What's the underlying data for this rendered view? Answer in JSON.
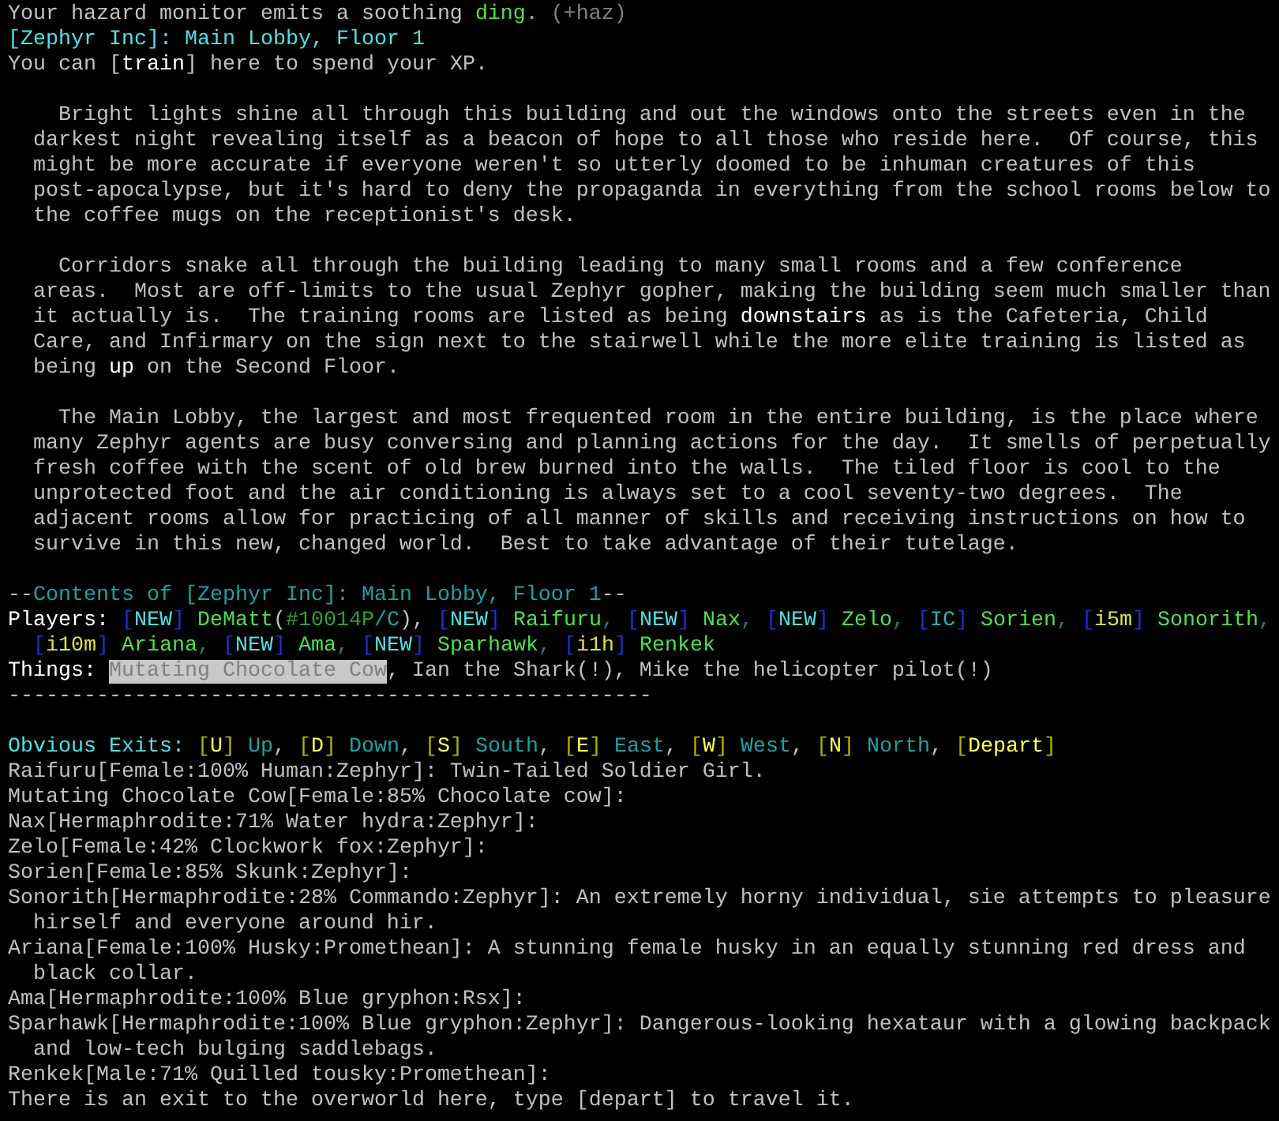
{
  "lines": [
    {
      "kind": "text",
      "segments": [
        {
          "text": "Your hazard monitor emits a soothing ",
          "color": "#c0c0c0"
        },
        {
          "text": "ding.",
          "color": "#4ee04e"
        },
        {
          "text": " (+haz)",
          "color": "#808080"
        }
      ]
    },
    {
      "kind": "text",
      "segments": [
        {
          "text": "[Zephyr Inc]: Main Lobby, Floor 1",
          "color": "#50e0e0"
        }
      ]
    },
    {
      "kind": "text",
      "segments": [
        {
          "text": "You can [",
          "color": "#c0c0c0"
        },
        {
          "text": "train",
          "color": "#ffffff"
        },
        {
          "text": "] here to spend your XP.",
          "color": "#c0c0c0"
        }
      ]
    },
    {
      "kind": "blank"
    },
    {
      "kind": "para",
      "segments": [
        {
          "text": "Bright lights shine all through this building and out the windows onto the streets even in the",
          "color": "#c0c0c0"
        }
      ]
    },
    {
      "kind": "wrap",
      "segments": [
        {
          "text": "darkest night revealing itself as a beacon of hope to all those who reside here.  Of course, this",
          "color": "#c0c0c0"
        }
      ]
    },
    {
      "kind": "wrap",
      "segments": [
        {
          "text": "might be more accurate if everyone weren't so utterly doomed to be inhuman creatures of this",
          "color": "#c0c0c0"
        }
      ]
    },
    {
      "kind": "wrap",
      "segments": [
        {
          "text": "post-apocalypse, but it's hard to deny the propaganda in everything from the school rooms below to",
          "color": "#c0c0c0"
        }
      ]
    },
    {
      "kind": "wrap",
      "segments": [
        {
          "text": "the coffee mugs on the receptionist's desk.",
          "color": "#c0c0c0"
        }
      ]
    },
    {
      "kind": "blank"
    },
    {
      "kind": "para",
      "segments": [
        {
          "text": "Corridors snake all through the building leading to many small rooms and a few conference",
          "color": "#c0c0c0"
        }
      ]
    },
    {
      "kind": "wrap",
      "segments": [
        {
          "text": "areas.  Most are off-limits to the usual Zephyr gopher, making the building seem much smaller than",
          "color": "#c0c0c0"
        }
      ]
    },
    {
      "kind": "wrap",
      "segments": [
        {
          "text": "it actually is.  The training rooms are listed as being ",
          "color": "#c0c0c0"
        },
        {
          "text": "downstairs",
          "color": "#ffffff"
        },
        {
          "text": " as is the Cafeteria, Child",
          "color": "#c0c0c0"
        }
      ]
    },
    {
      "kind": "wrap",
      "segments": [
        {
          "text": "Care, and Infirmary on the sign next to the stairwell while the more elite training is listed as",
          "color": "#c0c0c0"
        }
      ]
    },
    {
      "kind": "wrap",
      "segments": [
        {
          "text": "being ",
          "color": "#c0c0c0"
        },
        {
          "text": "up",
          "color": "#ffffff"
        },
        {
          "text": " on the Second Floor.",
          "color": "#c0c0c0"
        }
      ]
    },
    {
      "kind": "blank"
    },
    {
      "kind": "para",
      "segments": [
        {
          "text": "The Main Lobby, the largest and most frequented room in the entire building, is the place where",
          "color": "#c0c0c0"
        }
      ]
    },
    {
      "kind": "wrap",
      "segments": [
        {
          "text": "many Zephyr agents are busy conversing and planning actions for the day.  It smells of perpetually",
          "color": "#c0c0c0"
        }
      ]
    },
    {
      "kind": "wrap",
      "segments": [
        {
          "text": "fresh coffee with the scent of old brew burned into the walls.  The tiled floor is cool to the",
          "color": "#c0c0c0"
        }
      ]
    },
    {
      "kind": "wrap",
      "segments": [
        {
          "text": "unprotected foot and the air conditioning is always set to a cool seventy-two degrees.  The",
          "color": "#c0c0c0"
        }
      ]
    },
    {
      "kind": "wrap",
      "segments": [
        {
          "text": "adjacent rooms allow for practicing of all manner of skills and receiving instructions on how to",
          "color": "#c0c0c0"
        }
      ]
    },
    {
      "kind": "wrap",
      "segments": [
        {
          "text": "survive in this new, changed world.  Best to take advantage of their tutelage.",
          "color": "#c0c0c0"
        }
      ]
    },
    {
      "kind": "blank"
    },
    {
      "kind": "text",
      "segments": [
        {
          "text": "--",
          "color": "#c0c0c0"
        },
        {
          "text": "Contents of [Zephyr Inc]: Main Lobby, Floor 1",
          "color": "#20a0a0"
        },
        {
          "text": "--",
          "color": "#c0c0c0"
        }
      ]
    },
    {
      "kind": "text",
      "segments": [
        {
          "text": "Players: ",
          "color": "#ffffff"
        },
        {
          "text": "[",
          "color": "#2030d0"
        },
        {
          "text": "NEW",
          "color": "#50e0e0"
        },
        {
          "text": "]",
          "color": "#2030d0"
        },
        {
          "text": " DeMatt",
          "color": "#4ee04e"
        },
        {
          "text": "(",
          "color": "#c0c0c0"
        },
        {
          "text": "#10014P",
          "color": "#30a030"
        },
        {
          "text": "/C",
          "color": "#20a0a0"
        },
        {
          "text": "), ",
          "color": "#c0c0c0"
        },
        {
          "text": "[",
          "color": "#2030d0"
        },
        {
          "text": "NEW",
          "color": "#50e0e0"
        },
        {
          "text": "]",
          "color": "#2030d0"
        },
        {
          "text": " Raifuru",
          "color": "#4ee04e"
        },
        {
          "text": ", ",
          "color": "#208080"
        },
        {
          "text": "[",
          "color": "#2030d0"
        },
        {
          "text": "NEW",
          "color": "#50e0e0"
        },
        {
          "text": "]",
          "color": "#2030d0"
        },
        {
          "text": " Nax",
          "color": "#4ee04e"
        },
        {
          "text": ", ",
          "color": "#208080"
        },
        {
          "text": "[",
          "color": "#2030d0"
        },
        {
          "text": "NEW",
          "color": "#50e0e0"
        },
        {
          "text": "]",
          "color": "#2030d0"
        },
        {
          "text": " Zelo",
          "color": "#4ee04e"
        },
        {
          "text": ", ",
          "color": "#208080"
        },
        {
          "text": "[",
          "color": "#2030d0"
        },
        {
          "text": "IC",
          "color": "#30b0b0"
        },
        {
          "text": "]",
          "color": "#2030d0"
        },
        {
          "text": " Sorien",
          "color": "#4ee04e"
        },
        {
          "text": ", ",
          "color": "#208080"
        },
        {
          "text": "[",
          "color": "#2030d0"
        },
        {
          "text": "i5m",
          "color": "#e0e040"
        },
        {
          "text": "]",
          "color": "#2030d0"
        },
        {
          "text": " Sonorith",
          "color": "#4ee04e"
        },
        {
          "text": ",",
          "color": "#208080"
        }
      ]
    },
    {
      "kind": "wrap",
      "segments": [
        {
          "text": "[",
          "color": "#2030d0"
        },
        {
          "text": "i10m",
          "color": "#e0e040"
        },
        {
          "text": "]",
          "color": "#2030d0"
        },
        {
          "text": " Ariana",
          "color": "#4ee04e"
        },
        {
          "text": ", ",
          "color": "#208080"
        },
        {
          "text": "[",
          "color": "#2030d0"
        },
        {
          "text": "NEW",
          "color": "#50e0e0"
        },
        {
          "text": "]",
          "color": "#2030d0"
        },
        {
          "text": " Ama",
          "color": "#4ee04e"
        },
        {
          "text": ", ",
          "color": "#208080"
        },
        {
          "text": "[",
          "color": "#2030d0"
        },
        {
          "text": "NEW",
          "color": "#50e0e0"
        },
        {
          "text": "]",
          "color": "#2030d0"
        },
        {
          "text": " Sparhawk",
          "color": "#4ee04e"
        },
        {
          "text": ", ",
          "color": "#208080"
        },
        {
          "text": "[",
          "color": "#2030d0"
        },
        {
          "text": "i1h",
          "color": "#e0e040"
        },
        {
          "text": "]",
          "color": "#2030d0"
        },
        {
          "text": " Renkek",
          "color": "#4ee04e"
        }
      ]
    },
    {
      "kind": "text",
      "segments": [
        {
          "text": "Things: ",
          "color": "#ffffff",
          "highlighted": false
        },
        {
          "text": "Mutating Chocolate Cow",
          "color": "#808080",
          "highlighted": true
        },
        {
          "text": ", Ian the Shark(!), Mike the helicopter pilot(!)",
          "color": "#c0c0c0",
          "highlighted": false
        }
      ]
    },
    {
      "kind": "text",
      "segments": [
        {
          "text": "---------------------------------------------------",
          "color": "#c0c0c0"
        }
      ]
    },
    {
      "kind": "blank"
    },
    {
      "kind": "text",
      "segments": [
        {
          "text": "Obvious Exits: ",
          "color": "#50e0e0"
        },
        {
          "text": "[",
          "color": "#b0b000"
        },
        {
          "text": "U",
          "color": "#ffff55"
        },
        {
          "text": "]",
          "color": "#b0b000"
        },
        {
          "text": " Up",
          "color": "#20a0a0"
        },
        {
          "text": ", ",
          "color": "#c0c0c0"
        },
        {
          "text": "[",
          "color": "#b0b000"
        },
        {
          "text": "D",
          "color": "#ffff55"
        },
        {
          "text": "]",
          "color": "#b0b000"
        },
        {
          "text": " Down",
          "color": "#20a0a0"
        },
        {
          "text": ", ",
          "color": "#c0c0c0"
        },
        {
          "text": "[",
          "color": "#b0b000"
        },
        {
          "text": "S",
          "color": "#ffff55"
        },
        {
          "text": "]",
          "color": "#b0b000"
        },
        {
          "text": " South",
          "color": "#20a0a0"
        },
        {
          "text": ", ",
          "color": "#c0c0c0"
        },
        {
          "text": "[",
          "color": "#b0b000"
        },
        {
          "text": "E",
          "color": "#ffff55"
        },
        {
          "text": "]",
          "color": "#b0b000"
        },
        {
          "text": " East",
          "color": "#20a0a0"
        },
        {
          "text": ", ",
          "color": "#c0c0c0"
        },
        {
          "text": "[",
          "color": "#b0b000"
        },
        {
          "text": "W",
          "color": "#ffff55"
        },
        {
          "text": "]",
          "color": "#b0b000"
        },
        {
          "text": " West",
          "color": "#20a0a0"
        },
        {
          "text": ", ",
          "color": "#c0c0c0"
        },
        {
          "text": "[",
          "color": "#b0b000"
        },
        {
          "text": "N",
          "color": "#ffff55"
        },
        {
          "text": "]",
          "color": "#b0b000"
        },
        {
          "text": " North",
          "color": "#20a0a0"
        },
        {
          "text": ", ",
          "color": "#c0c0c0"
        },
        {
          "text": "[",
          "color": "#b0b000"
        },
        {
          "text": "Depart",
          "color": "#ffff55"
        },
        {
          "text": "]",
          "color": "#b0b000"
        }
      ]
    },
    {
      "kind": "text",
      "segments": [
        {
          "text": "Raifuru[Female:100% Human:Zephyr]: Twin-Tailed Soldier Girl.",
          "color": "#c0c0c0"
        }
      ]
    },
    {
      "kind": "text",
      "segments": [
        {
          "text": "Mutating Chocolate Cow[Female:85% Chocolate cow]:",
          "color": "#c0c0c0"
        }
      ]
    },
    {
      "kind": "text",
      "segments": [
        {
          "text": "Nax[Hermaphrodite:71% Water hydra:Zephyr]:",
          "color": "#c0c0c0"
        }
      ]
    },
    {
      "kind": "text",
      "segments": [
        {
          "text": "Zelo[Female:42% Clockwork fox:Zephyr]:",
          "color": "#c0c0c0"
        }
      ]
    },
    {
      "kind": "text",
      "segments": [
        {
          "text": "Sorien[Female:85% Skunk:Zephyr]:",
          "color": "#c0c0c0"
        }
      ]
    },
    {
      "kind": "text",
      "segments": [
        {
          "text": "Sonorith[Hermaphrodite:28% Commando:Zephyr]: An extremely horny individual, sie attempts to pleasure",
          "color": "#c0c0c0"
        }
      ]
    },
    {
      "kind": "wrap",
      "segments": [
        {
          "text": "hirself and everyone around hir.",
          "color": "#c0c0c0"
        }
      ]
    },
    {
      "kind": "text",
      "segments": [
        {
          "text": "Ariana[Female:100% Husky:Promethean]: A stunning female husky in an equally stunning red dress and",
          "color": "#c0c0c0"
        }
      ]
    },
    {
      "kind": "wrap",
      "segments": [
        {
          "text": "black collar.",
          "color": "#c0c0c0"
        }
      ]
    },
    {
      "kind": "text",
      "segments": [
        {
          "text": "Ama[Hermaphrodite:100% Blue gryphon:Rsx]:",
          "color": "#c0c0c0"
        }
      ]
    },
    {
      "kind": "text",
      "segments": [
        {
          "text": "Sparhawk[Hermaphrodite:100% Blue gryphon:Zephyr]: Dangerous-looking hexataur with a glowing backpack",
          "color": "#c0c0c0"
        }
      ]
    },
    {
      "kind": "wrap",
      "segments": [
        {
          "text": "and low-tech bulging saddlebags.",
          "color": "#c0c0c0"
        }
      ]
    },
    {
      "kind": "text",
      "segments": [
        {
          "text": "Renkek[Male:71% Quilled tousky:Promethean]:",
          "color": "#c0c0c0"
        }
      ]
    },
    {
      "kind": "text",
      "segments": [
        {
          "text": "There is an exit to the overworld here, type [depart] to travel it.",
          "color": "#c0c0c0"
        }
      ]
    }
  ]
}
